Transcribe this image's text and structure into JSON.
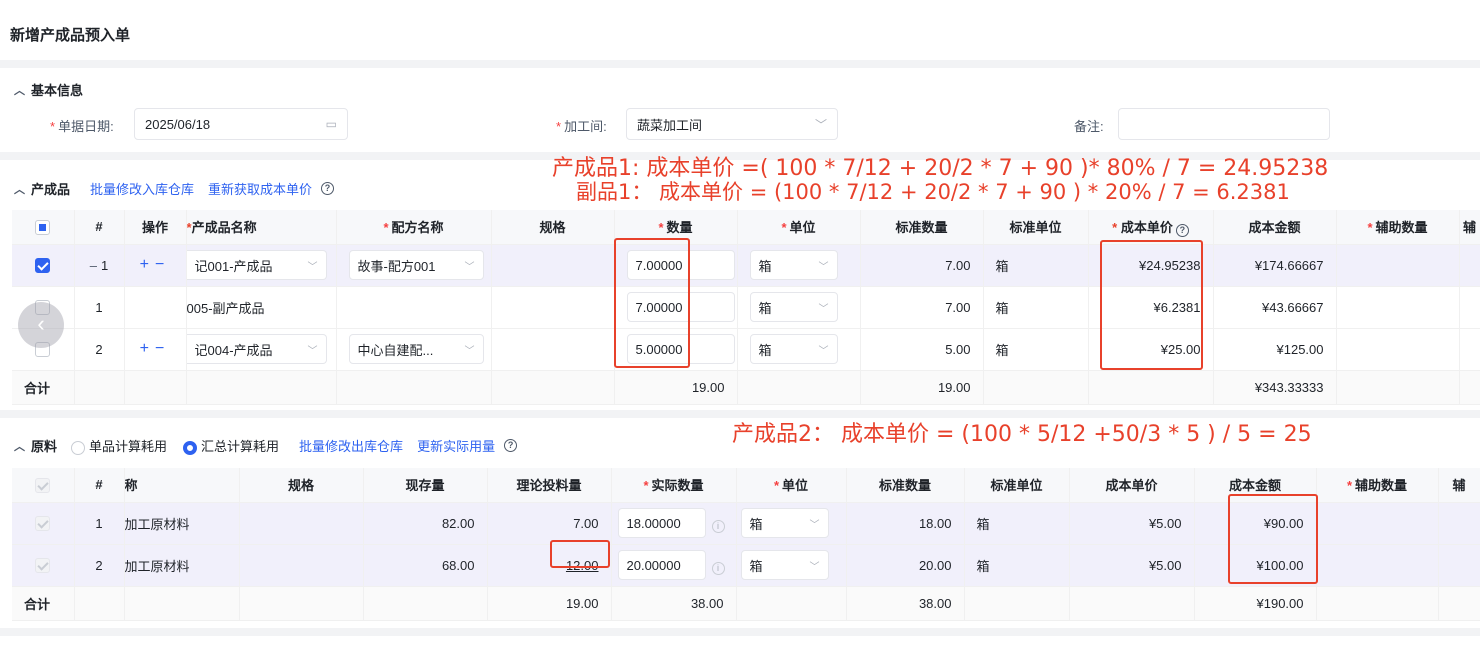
{
  "page": {
    "title": "新增产成品预入单"
  },
  "basic": {
    "title": "基本信息",
    "date_label": "单据日期:",
    "date_value": "2025/06/18",
    "workshop_label": "加工间:",
    "workshop_value": "蔬菜加工间",
    "remark_label": "备注:",
    "remark_value": ""
  },
  "products": {
    "title": "产成品",
    "link_batch": "批量修改入库仓库",
    "link_refresh": "重新获取成本单价",
    "headers": [
      "#",
      "操作",
      "产成品名称",
      "配方名称",
      "规格",
      "数量",
      "单位",
      "标准数量",
      "标准单位",
      "成本单价",
      "成本金额",
      "辅助数量",
      "辅"
    ],
    "rows": [
      {
        "idx": "1",
        "name": "记001-产成品",
        "recipe": "故事-配方001",
        "qty": "7.00000",
        "unit": "箱",
        "std_qty": "7.00",
        "std_unit": "箱",
        "price": "¥24.95238",
        "amount": "¥174.66667"
      },
      {
        "idx": "1",
        "name": "005-副产成品",
        "recipe": "",
        "qty": "7.00000",
        "unit": "箱",
        "std_qty": "7.00",
        "std_unit": "箱",
        "price": "¥6.2381",
        "amount": "¥43.66667"
      },
      {
        "idx": "2",
        "name": "记004-产成品",
        "recipe": "中心自建配...",
        "qty": "5.00000",
        "unit": "箱",
        "std_qty": "5.00",
        "std_unit": "箱",
        "price": "¥25.00",
        "amount": "¥125.00"
      }
    ],
    "total": {
      "label": "合计",
      "qty": "19.00",
      "std_qty": "19.00",
      "amount": "¥343.33333"
    }
  },
  "materials": {
    "title": "原料",
    "radio_single": "单品计算耗用",
    "radio_sum": "汇总计算耗用",
    "link_batch": "批量修改出库仓库",
    "link_update": "更新实际用量",
    "headers": [
      "#",
      "称",
      "规格",
      "现存量",
      "理论投料量",
      "实际数量",
      "单位",
      "标准数量",
      "标准单位",
      "成本单价",
      "成本金额",
      "辅助数量",
      "辅"
    ],
    "rows": [
      {
        "idx": "1",
        "name": "加工原材料",
        "stock": "82.00",
        "theory": "7.00",
        "actual": "18.00000",
        "unit": "箱",
        "std_qty": "18.00",
        "std_unit": "箱",
        "price": "¥5.00",
        "amount": "¥90.00"
      },
      {
        "idx": "2",
        "name": "加工原材料",
        "stock": "68.00",
        "theory": "12.00",
        "actual": "20.00000",
        "unit": "箱",
        "std_qty": "20.00",
        "std_unit": "箱",
        "price": "¥5.00",
        "amount": "¥100.00"
      }
    ],
    "total": {
      "label": "合计",
      "theory": "19.00",
      "actual": "38.00",
      "std_qty": "38.00",
      "amount": "¥190.00"
    }
  },
  "annotations": {
    "line1": "产成品1:  成本单价 =( 100 * 7/12  + 20/2 * 7  + 90  )* 80%  /  7 = 24.95238",
    "line2": "副品1：  成本单价 =   (100 * 7/12  + 20/2 * 7  + 90 ) * 20%  / 7 = 6.2381",
    "line3": "产成品2：  成本单价 = (100 *  5/12 +50/3 * 5 ) / 5 = 25"
  }
}
